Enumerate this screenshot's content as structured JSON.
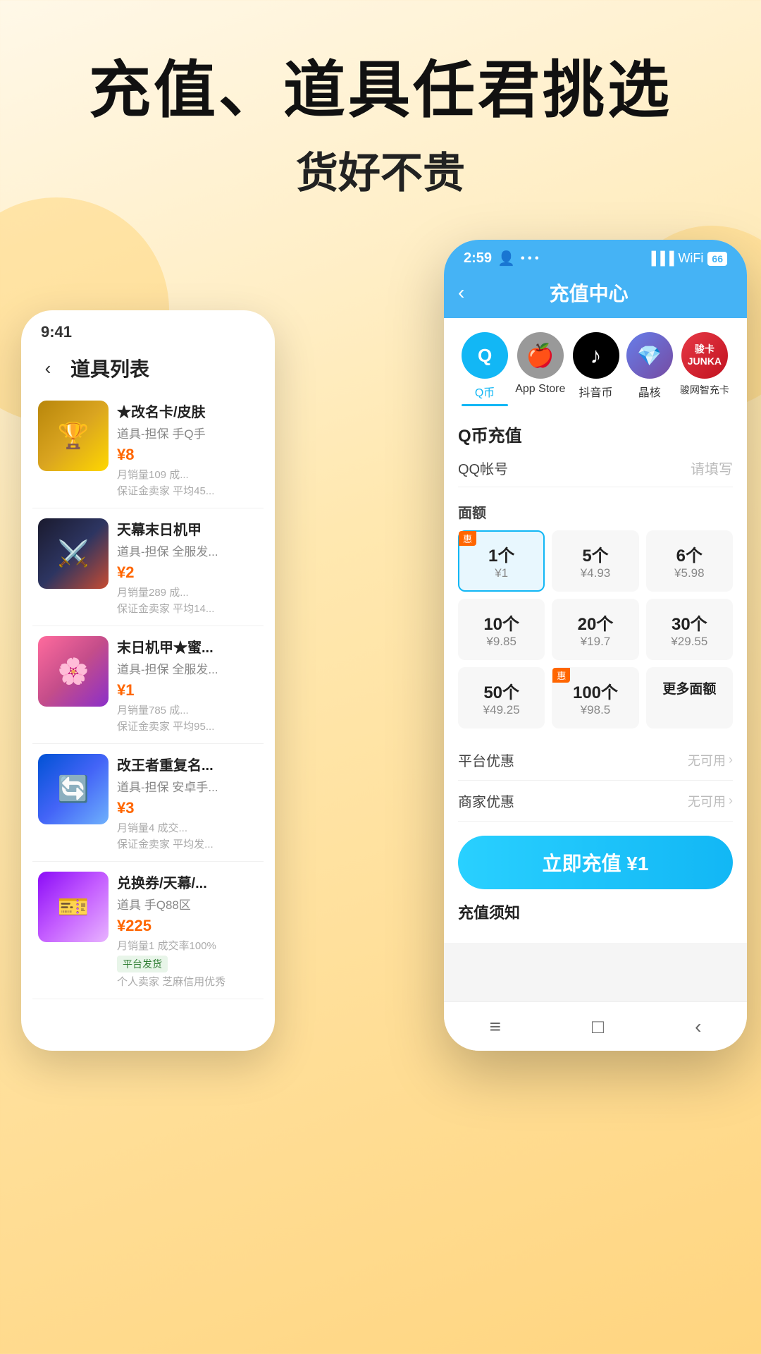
{
  "headline": "充值、道具任君挑选",
  "subheadline": "货好不贵",
  "leftPhone": {
    "statusTime": "9:41",
    "backLabel": "‹",
    "pageTitle": "道具列表",
    "items": [
      {
        "emoji": "🏆",
        "imgClass": "gold",
        "name": "★改名卡/皮肤",
        "type": "道具-担保 手Q手",
        "price": "¥8",
        "sales": "月销量109 成...",
        "guarantee": "保证金卖家 平均45..."
      },
      {
        "emoji": "⚔️",
        "imgClass": "dark",
        "name": "天幕末日机甲",
        "type": "道具-担保 全服发...",
        "price": "¥2",
        "sales": "月销量289 成...",
        "guarantee": "保证金卖家 平均14..."
      },
      {
        "emoji": "🌸",
        "imgClass": "pink",
        "name": "末日机甲★蜜...",
        "type": "道具-担保 全服发...",
        "price": "¥1",
        "sales": "月销量785 成...",
        "guarantee": "保证金卖家 平均95..."
      },
      {
        "emoji": "🔄",
        "imgClass": "blue",
        "name": "改王者重复名...",
        "type": "道具-担保 安卓手...",
        "price": "¥3",
        "sales": "月销量4 成交...",
        "guarantee": "保证金卖家 平均发..."
      },
      {
        "emoji": "🎫",
        "imgClass": "purple",
        "name": "兑换券/天幕/...",
        "type": "道具 手Q88区",
        "price": "¥225",
        "sales": "月销量1 成交率100%",
        "guarantee": "平台发货",
        "badge": "平台发货",
        "extra": "个人卖家 芝麻信用优秀"
      }
    ]
  },
  "rightPhone": {
    "statusTime": "2:59",
    "statusIcon": "👤",
    "pageTitle": "充值中心",
    "categories": [
      {
        "label": "Q币",
        "icon": "Q",
        "iconClass": "qq",
        "active": true
      },
      {
        "label": "App Store",
        "icon": "",
        "iconClass": "apple",
        "active": false
      },
      {
        "label": "抖音币",
        "icon": "♪",
        "iconClass": "douyin",
        "active": false
      },
      {
        "label": "晶核",
        "icon": "💎",
        "iconClass": "crystal",
        "active": false
      },
      {
        "label": "骏网智充卡",
        "icon": "骏卡",
        "iconClass": "junka",
        "active": false
      }
    ],
    "sectionTitle": "Q币充值",
    "inputLabel": "QQ帐号",
    "inputPlaceholder": "请填写",
    "denominationLabel": "面额",
    "denominations": [
      {
        "num": "1个",
        "price": "¥1",
        "active": true,
        "badge": "惠"
      },
      {
        "num": "5个",
        "price": "¥4.93",
        "active": false,
        "badge": ""
      },
      {
        "num": "6个",
        "price": "¥5.98",
        "active": false,
        "badge": ""
      },
      {
        "num": "10个",
        "price": "¥9.85",
        "active": false,
        "badge": ""
      },
      {
        "num": "20个",
        "price": "¥19.7",
        "active": false,
        "badge": ""
      },
      {
        "num": "30个",
        "price": "¥29.55",
        "active": false,
        "badge": ""
      },
      {
        "num": "50个",
        "price": "¥49.25",
        "active": false,
        "badge": ""
      },
      {
        "num": "100个",
        "price": "¥98.5",
        "active": false,
        "badge": "惠"
      },
      {
        "num": "更多面额",
        "price": "",
        "active": false,
        "badge": ""
      }
    ],
    "platformDiscount": "平台优惠",
    "platformDiscountValue": "无可用",
    "merchantDiscount": "商家优惠",
    "merchantDiscountValue": "无可用",
    "chargeButton": "立即充值 ¥1",
    "noticeTitle": "充值须知",
    "bottomNav": [
      "≡",
      "□",
      "‹"
    ]
  }
}
